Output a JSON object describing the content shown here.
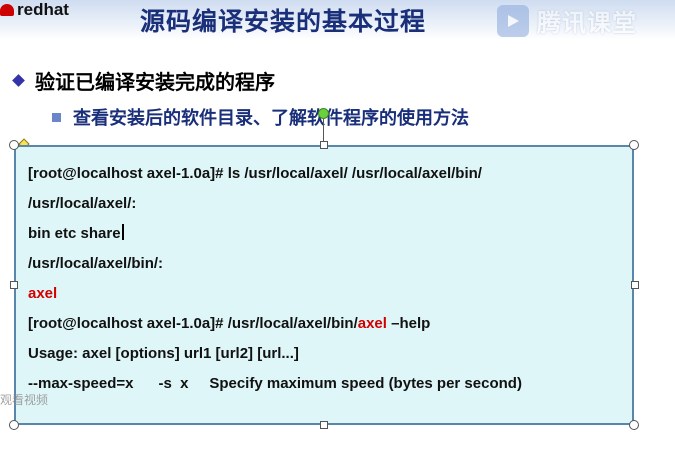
{
  "header": {
    "logo_text": "redhat",
    "title": "源码编译安装的基本过程",
    "watermark": "腾讯课堂"
  },
  "bullets": {
    "level1": "验证已编译安装完成的程序",
    "level2": "查看安装后的软件目录、了解软件程序的使用方法"
  },
  "code": {
    "line1_prompt": "[root@localhost axel-1.0a]# ",
    "line1_cmd": "ls /usr/local/axel/  /usr/local/axel/bin/",
    "line2": "/usr/local/axel/:",
    "line3": "bin  etc  share",
    "line4": "/usr/local/axel/bin/:",
    "line5": "axel",
    "line6_prompt": "[root@localhost axel-1.0a]# ",
    "line6_path": "/usr/local/axel/bin/",
    "line6_prog": "axel",
    "line6_arg": " –help",
    "line7": "Usage: axel [options] url1 [url2] [url...]",
    "line8_opt": "--max-speed=x      -s  x     ",
    "line8_desc": "Specify maximum speed (bytes per second)"
  },
  "overlay": {
    "bottom_watermark": "观看视频"
  },
  "colors": {
    "title": "#1a2f7a",
    "code_bg": "#dff6f8",
    "highlight": "#d40000"
  }
}
